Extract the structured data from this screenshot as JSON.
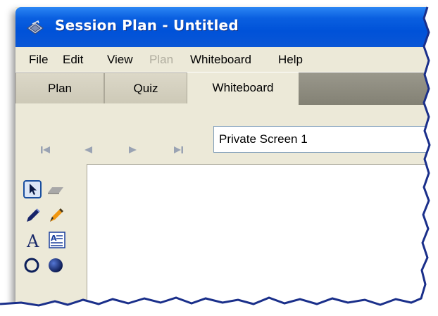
{
  "window": {
    "title": "Session Plan - Untitled"
  },
  "menu": {
    "items": [
      {
        "label": "File",
        "enabled": true
      },
      {
        "label": "Edit",
        "enabled": true
      },
      {
        "label": "View",
        "enabled": true
      },
      {
        "label": "Plan",
        "enabled": false
      },
      {
        "label": "Whiteboard",
        "enabled": true
      },
      {
        "label": "Help",
        "enabled": true
      }
    ]
  },
  "tabs": {
    "items": [
      {
        "label": "Plan",
        "active": false
      },
      {
        "label": "Quiz",
        "active": false
      },
      {
        "label": "Whiteboard",
        "active": true
      }
    ]
  },
  "navigation": {
    "buttons": [
      "first-icon",
      "previous-icon",
      "next-icon",
      "last-icon"
    ],
    "screen_selector": {
      "value": "Private Screen 1"
    }
  },
  "tools": {
    "items": [
      {
        "name": "pointer-tool-icon",
        "selected": true
      },
      {
        "name": "eraser-tool-icon",
        "selected": false
      },
      {
        "name": "pen-tool-icon",
        "selected": false
      },
      {
        "name": "highlighter-tool-icon",
        "selected": false
      },
      {
        "name": "text-tool-icon",
        "selected": false,
        "glyph": "A"
      },
      {
        "name": "textbox-tool-icon",
        "selected": false
      },
      {
        "name": "circle-outline-tool-icon",
        "selected": false
      },
      {
        "name": "circle-filled-tool-icon",
        "selected": false
      }
    ]
  },
  "colors": {
    "titlebar": "#0052d8",
    "window_bg": "#ece9d8",
    "tab_fill": "#8d8b7f",
    "canvas": "#ffffff"
  }
}
